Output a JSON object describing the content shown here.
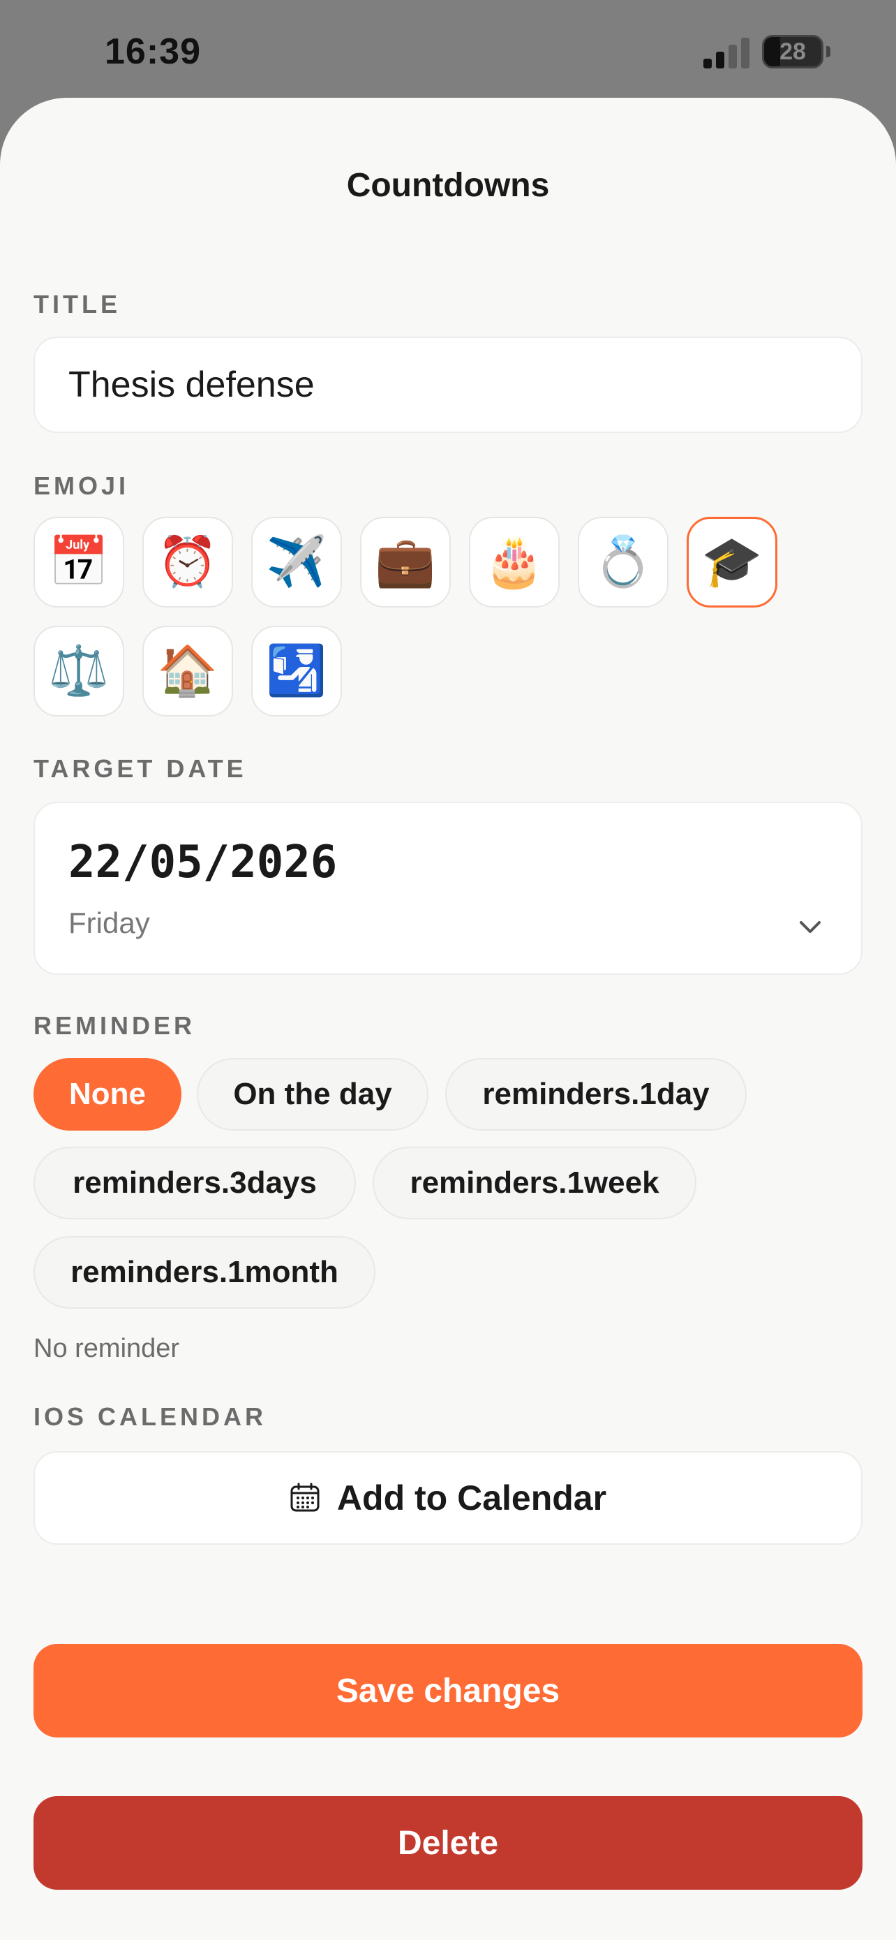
{
  "status_bar": {
    "time": "16:39",
    "battery": "28"
  },
  "header": {
    "title": "Countdowns"
  },
  "title_section": {
    "label": "TITLE",
    "value": "Thesis defense"
  },
  "emoji_section": {
    "label": "EMOJI",
    "options": [
      {
        "name": "calendar",
        "glyph": "📅"
      },
      {
        "name": "alarm-clock",
        "glyph": "⏰"
      },
      {
        "name": "airplane",
        "glyph": "✈️"
      },
      {
        "name": "briefcase",
        "glyph": "💼"
      },
      {
        "name": "birthday-cake",
        "glyph": "🎂"
      },
      {
        "name": "ring",
        "glyph": "💍"
      },
      {
        "name": "graduation-cap",
        "glyph": "🎓"
      },
      {
        "name": "balance-scale",
        "glyph": "⚖️"
      },
      {
        "name": "house",
        "glyph": "🏠"
      },
      {
        "name": "passport-control",
        "glyph": "🛂"
      }
    ],
    "selected": "graduation-cap"
  },
  "target_date": {
    "label": "TARGET DATE",
    "date": "22/05/2026",
    "weekday": "Friday"
  },
  "reminder": {
    "label": "REMINDER",
    "options": [
      "None",
      "On the day",
      "reminders.1day",
      "reminders.3days",
      "reminders.1week",
      "reminders.1month"
    ],
    "selected": "None",
    "helper": "No reminder"
  },
  "ios_calendar": {
    "label": "IOS CALENDAR",
    "button_label": "Add to Calendar"
  },
  "actions": {
    "save_label": "Save changes",
    "delete_label": "Delete"
  },
  "colors": {
    "accent": "#ff6b35",
    "danger": "#c2392d",
    "sheet_background": "#f8f8f6"
  }
}
